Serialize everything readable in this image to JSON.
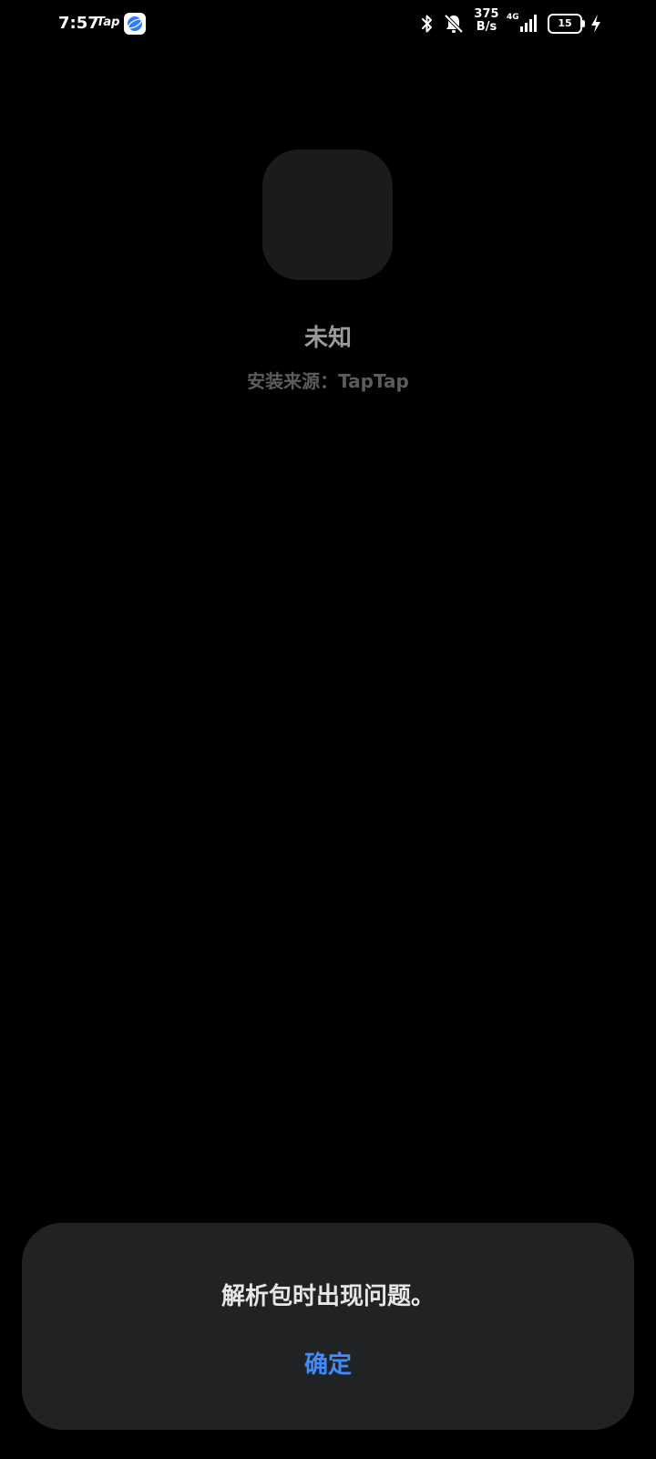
{
  "status_bar": {
    "time": "7:57",
    "notification_app": "Tap",
    "net_speed_value": "375",
    "net_speed_unit": "B/s",
    "network_type": "4G",
    "battery_level": "15"
  },
  "icons": {
    "app_notification": "browser-globe-icon",
    "bluetooth": "bluetooth-icon",
    "mute": "bell-off-icon",
    "signal": "signal-bars-icon",
    "battery": "battery-icon",
    "charging": "charging-bolt-icon"
  },
  "app_info": {
    "name": "未知",
    "install_source": "安装来源：TapTap"
  },
  "dialog": {
    "message": "解析包时出现问题。",
    "confirm_label": "确定"
  },
  "colors": {
    "background": "#000000",
    "dialog_background": "#212224",
    "accent": "#3f8cff"
  }
}
